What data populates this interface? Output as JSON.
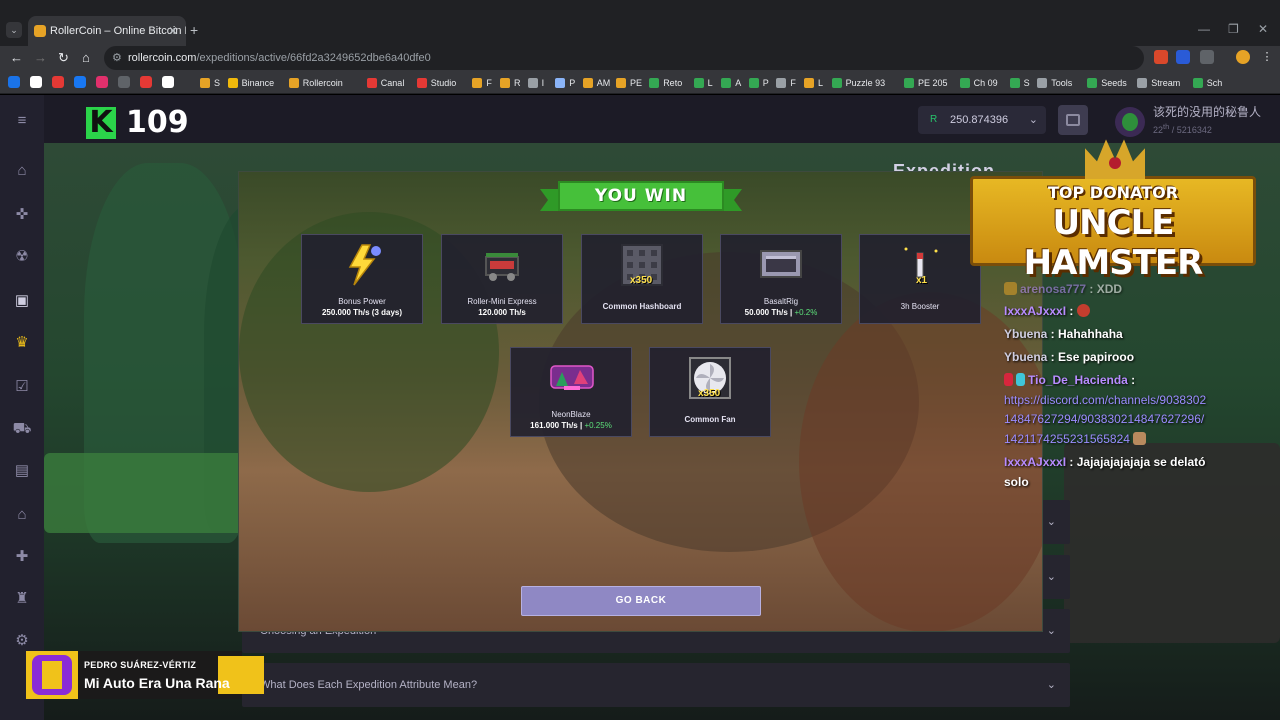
{
  "browser": {
    "tab_title": "RollerCoin – Online Bitcoin Mi",
    "url_domain": "rollercoin.com",
    "url_path": "/expeditions/active/66fd2a3249652dbe6a40dfe0",
    "bookmarks": [
      "S",
      "Binance",
      "Rollercoin",
      "Canal",
      "Studio",
      "F",
      "R",
      "I",
      "P",
      "AM",
      "PE",
      "Reto",
      "L",
      "A",
      "P",
      "F",
      "L",
      "Puzzle 93",
      "PE 205",
      "Ch 09",
      "S",
      "Tools",
      "Seeds",
      "Stream",
      "Sch"
    ]
  },
  "header": {
    "level": "109",
    "balance": "250.874396",
    "currency_symbol": "R",
    "username": "该死的没用的秘鲁人",
    "rank": "22",
    "rank_suffix": "th",
    "rank_total": "/ 5216342",
    "page_title": "Expedition"
  },
  "modal": {
    "banner": "YOU WIN",
    "rewards": [
      {
        "name": "Bonus Power",
        "value": "250.000 Th/s (3 days)",
        "pct": "",
        "mult": ""
      },
      {
        "name": "Roller-Mini Express",
        "value": "120.000 Th/s",
        "pct": "",
        "mult": ""
      },
      {
        "name": "Common Hashboard",
        "value": "",
        "pct": "",
        "mult": "x350"
      },
      {
        "name": "BasaltRig",
        "value": "50.000 Th/s",
        "pct": "+0.2%",
        "mult": ""
      },
      {
        "name": "3h Booster",
        "value": "",
        "pct": "",
        "mult": "x1"
      },
      {
        "name": "NeonBlaze",
        "value": "161.000 Th/s",
        "pct": "+0.25%",
        "mult": ""
      },
      {
        "name": "Common Fan",
        "value": "",
        "pct": "",
        "mult": "x350"
      }
    ],
    "go_back": "GO BACK"
  },
  "faq": [
    {
      "label": ""
    },
    {
      "label": ""
    },
    {
      "label": "Choosing an Expedition"
    },
    {
      "label": "What Does Each Expedition Attribute Mean?"
    }
  ],
  "overlay": {
    "donator_top": "TOP DONATOR",
    "donator_name": "UNCLE HAMSTER",
    "chat": [
      {
        "user": "arenosa777",
        "text": "XDD"
      },
      {
        "user": "IxxxAJxxxI",
        "text": ""
      },
      {
        "user": "Ybuena",
        "text": "Hahahhaha"
      },
      {
        "user": "Ybuena",
        "text": "Ese papirooo"
      },
      {
        "user": "Tio_De_Hacienda",
        "text": ""
      },
      {
        "user": "",
        "text": "https://discord.com/channels/9038302"
      },
      {
        "user": "",
        "text": "14847627294/903830214847627296/"
      },
      {
        "user": "",
        "text": "1421174255231565824"
      },
      {
        "user": "IxxxAJxxxI",
        "text": "Jajajajajajaja se delató"
      },
      {
        "user": "",
        "text": "solo"
      }
    ],
    "streamer": "PEDRO SUÁREZ-VÉRTIZ",
    "song": "Mi Auto Era Una Rana"
  }
}
